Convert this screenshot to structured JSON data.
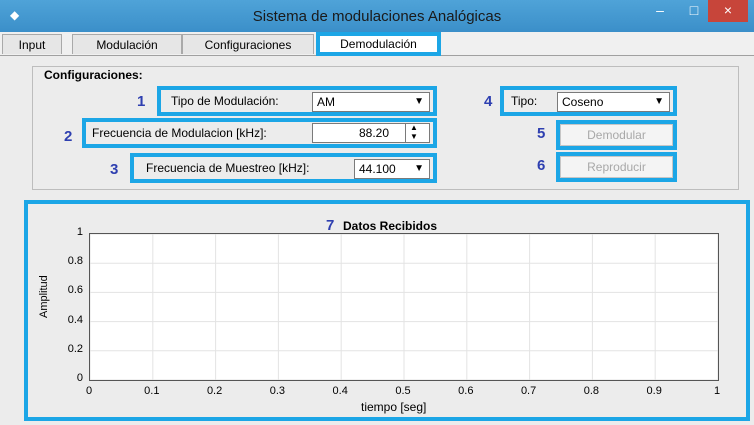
{
  "window": {
    "title": "Sistema de modulaciones Analógicas",
    "min": "–",
    "max": "□",
    "close": "×"
  },
  "tabs": [
    {
      "label": "Input"
    },
    {
      "label": "Modulación"
    },
    {
      "label": "Configuraciones"
    },
    {
      "label": "Demodulación",
      "selected": true
    }
  ],
  "panel": {
    "title": "Configuraciones:",
    "items": {
      "n1": "1",
      "tipo_mod_label": "Tipo de Modulación:",
      "tipo_mod_value": "AM",
      "n2": "2",
      "frec_mod_label": "Frecuencia de Modulacion [kHz]:",
      "frec_mod_value": "88.20",
      "n3": "3",
      "frec_muestreo_label": "Frecuencia de Muestreo [kHz]:",
      "frec_muestreo_value": "44.100",
      "n4": "4",
      "tipo_label": "Tipo:",
      "tipo_value": "Coseno",
      "n5": "5",
      "demodular": "Demodular",
      "n6": "6",
      "reproducir": "Reproducir"
    }
  },
  "plot": {
    "n7": "7",
    "title": "Datos Recibidos",
    "ylabel": "Amplitud",
    "xlabel": "tiempo [seg]",
    "yticks": [
      "0",
      "0.2",
      "0.4",
      "0.6",
      "0.8",
      "1"
    ],
    "xticks": [
      "0",
      "0.1",
      "0.2",
      "0.3",
      "0.4",
      "0.5",
      "0.6",
      "0.7",
      "0.8",
      "0.9",
      "1"
    ]
  },
  "colors": {
    "highlight": "#1ca6e6",
    "number": "#2e3fb0",
    "titlebar": "#3b8fc9",
    "close": "#c7453a"
  }
}
